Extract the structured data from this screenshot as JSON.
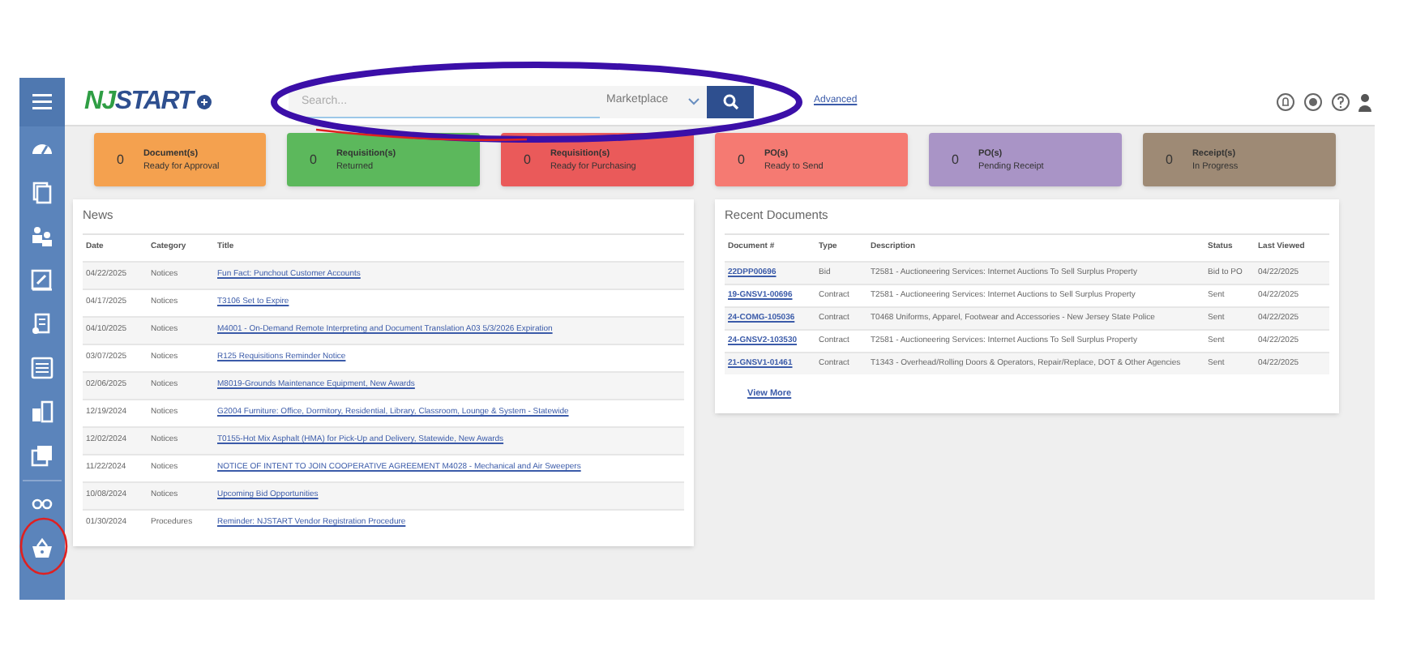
{
  "logo": {
    "part_1": "NJ",
    "part_2": "START"
  },
  "search": {
    "placeholder": "Search...",
    "scope": "Marketplace",
    "advanced": "Advanced"
  },
  "sidebar": {
    "items": [
      {
        "kind": "gauge",
        "selected": false
      },
      {
        "kind": "docs",
        "selected": false
      },
      {
        "kind": "people",
        "selected": false
      },
      {
        "kind": "edit",
        "selected": false
      },
      {
        "kind": "receipt",
        "selected": false
      },
      {
        "kind": "list",
        "selected": false
      },
      {
        "kind": "split",
        "selected": false
      },
      {
        "kind": "photo",
        "selected": false
      },
      {
        "kind": "glasses",
        "selected": false
      },
      {
        "kind": "basket",
        "selected": false
      }
    ]
  },
  "summary_cards": [
    {
      "count": "0",
      "title": "Document(s)",
      "subtitle": "Ready for Approval",
      "color": "#f4a14f"
    },
    {
      "count": "0",
      "title": "Requisition(s)",
      "subtitle": "Returned",
      "color": "#5cb85c"
    },
    {
      "count": "0",
      "title": "Requisition(s)",
      "subtitle": "Ready for Purchasing",
      "color": "#ea5a5a"
    },
    {
      "count": "0",
      "title": "PO(s)",
      "subtitle": "Ready to Send",
      "color": "#f57a72"
    },
    {
      "count": "0",
      "title": "PO(s)",
      "subtitle": "Pending Receipt",
      "color": "#a994c6"
    },
    {
      "count": "0",
      "title": "Receipt(s)",
      "subtitle": "In Progress",
      "color": "#9e8a75"
    }
  ],
  "news": {
    "title": "News",
    "columns": [
      "Date",
      "Category",
      "Title"
    ],
    "rows": [
      [
        "04/22/2025",
        "Notices",
        "Fun Fact: Punchout Customer Accounts"
      ],
      [
        "04/17/2025",
        "Notices",
        "T3106 Set to Expire"
      ],
      [
        "04/10/2025",
        "Notices",
        "M4001 - On-Demand Remote Interpreting and Document Translation A03 5/3/2026 Expiration"
      ],
      [
        "03/07/2025",
        "Notices",
        "R125 Requisitions Reminder Notice"
      ],
      [
        "02/06/2025",
        "Notices",
        "M8019-Grounds Maintenance Equipment, New Awards"
      ],
      [
        "12/19/2024",
        "Notices",
        "G2004 Furniture: Office, Dormitory, Residential, Library, Classroom, Lounge & System - Statewide"
      ],
      [
        "12/02/2024",
        "Notices",
        "T0155-Hot Mix Asphalt (HMA) for Pick-Up and Delivery, Statewide, New Awards"
      ],
      [
        "11/22/2024",
        "Notices",
        "NOTICE OF INTENT TO JOIN COOPERATIVE AGREEMENT M4028 - Mechanical and Air Sweepers"
      ],
      [
        "10/08/2024",
        "Notices",
        "Upcoming Bid Opportunities"
      ],
      [
        "01/30/2024",
        "Procedures",
        "Reminder: NJSTART Vendor Registration Procedure"
      ]
    ]
  },
  "recent_documents": {
    "title": "Recent Documents",
    "columns": [
      "Document #",
      "Type",
      "Description",
      "Status",
      "Last Viewed"
    ],
    "rows": [
      [
        "22DPP00696",
        "Bid",
        "T2581 - Auctioneering Services: Internet Auctions To Sell Surplus Property",
        "Bid to PO",
        "04/22/2025"
      ],
      [
        "19-GNSV1-00696",
        "Contract",
        "T2581 - Auctioneering Services: Internet Auctions to Sell Surplus Property",
        "Sent",
        "04/22/2025"
      ],
      [
        "24-COMG-105036",
        "Contract",
        "T0468 Uniforms, Apparel, Footwear and Accessories - New Jersey State Police",
        "Sent",
        "04/22/2025"
      ],
      [
        "24-GNSV2-103530",
        "Contract",
        "T2581 - Auctioneering Services: Internet Auctions To Sell Surplus Property",
        "Sent",
        "04/22/2025"
      ],
      [
        "21-GNSV1-01461",
        "Contract",
        "T1343 - Overhead/Rolling Doors & Operators, Repair/Replace, DOT & Other Agencies",
        "Sent",
        "04/22/2025"
      ]
    ],
    "view_more": "View More"
  }
}
